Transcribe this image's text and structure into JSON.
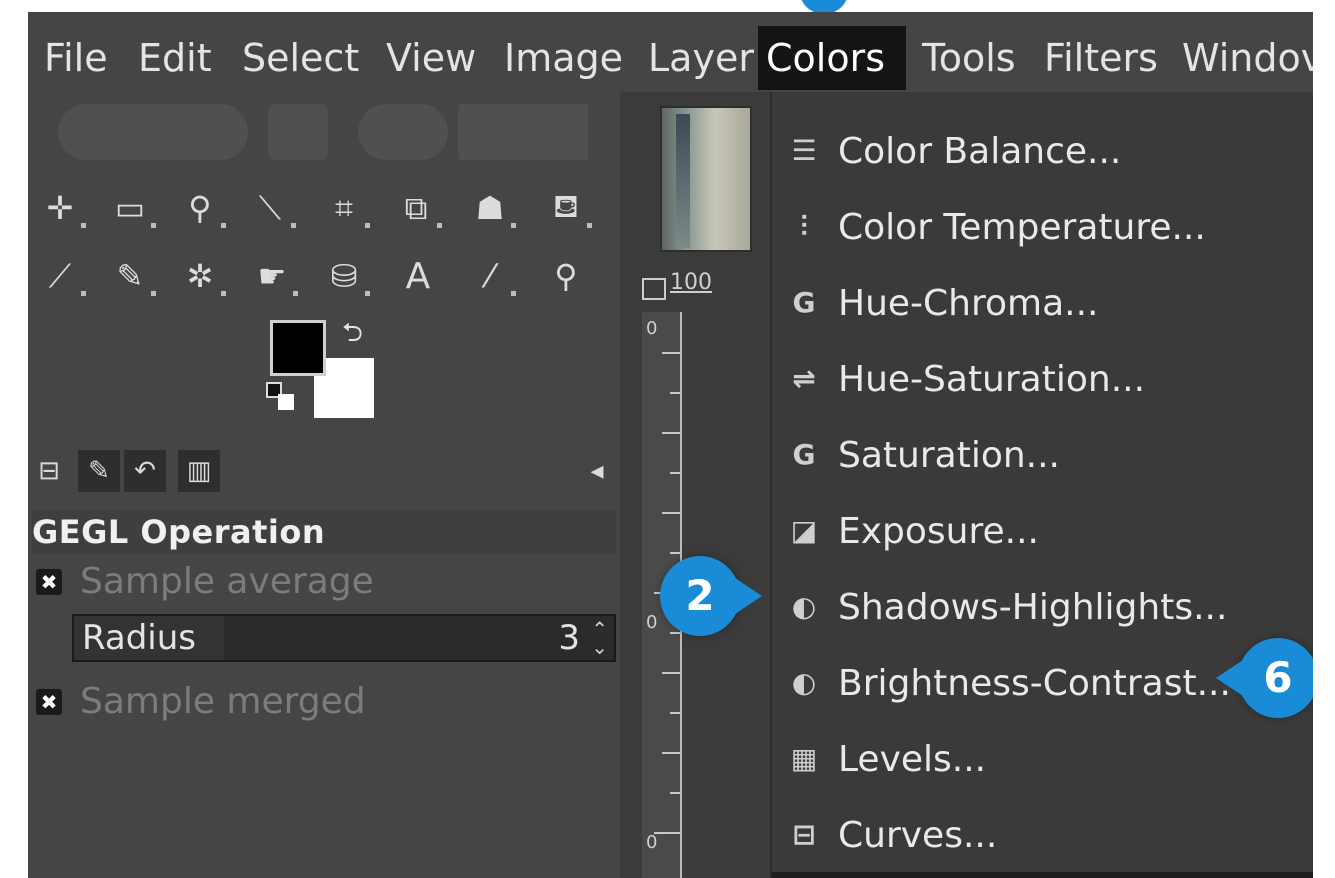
{
  "menubar": {
    "items": [
      {
        "label": "File",
        "active": false
      },
      {
        "label": "Edit",
        "active": false
      },
      {
        "label": "Select",
        "active": false
      },
      {
        "label": "View",
        "active": false
      },
      {
        "label": "Image",
        "active": false
      },
      {
        "label": "Layer",
        "active": false
      },
      {
        "label": "Colors",
        "active": true
      },
      {
        "label": "Tools",
        "active": false
      },
      {
        "label": "Filters",
        "active": false
      },
      {
        "label": "Windov",
        "active": false
      }
    ]
  },
  "toolbox": {
    "tools_row1": [
      "move-tool-icon",
      "rect-select-icon",
      "lasso-icon",
      "fuzzy-select-icon",
      "crop-icon",
      "transform-icon",
      "warp-icon",
      "bucket-fill-icon"
    ],
    "tools_row2": [
      "paintbrush-icon",
      "eraser-icon",
      "airbrush-icon",
      "smudge-icon",
      "clone-icon",
      "text-icon",
      "color-picker-icon",
      "zoom-icon"
    ],
    "dock_tabs": [
      "tool-options-icon",
      "device-status-icon",
      "undo-history-icon",
      "images-icon"
    ],
    "foreground_color": "#000000",
    "background_color": "#ffffff"
  },
  "tool_options": {
    "title": "GEGL Operation",
    "sample_average_label": "Sample average",
    "radius_label": "Radius",
    "radius_value": "3",
    "sample_merged_label": "Sample merged"
  },
  "canvas": {
    "zoom_label": "100",
    "ruler_label_top": "0",
    "ruler_label_mid": "0",
    "ruler_label_bottom": "0"
  },
  "colors_menu": {
    "items": [
      {
        "label": "Color Balance...",
        "icon": "color-balance-icon",
        "glyph": "☰"
      },
      {
        "label": "Color Temperature...",
        "icon": "color-temperature-icon",
        "glyph": "⫶"
      },
      {
        "label": "Hue-Chroma...",
        "icon": "gegl-icon",
        "glyph": "G"
      },
      {
        "label": "Hue-Saturation...",
        "icon": "hue-saturation-icon",
        "glyph": "⇌"
      },
      {
        "label": "Saturation...",
        "icon": "gegl-icon",
        "glyph": "G"
      },
      {
        "label": "Exposure...",
        "icon": "exposure-icon",
        "glyph": "◪"
      },
      {
        "label": "Shadows-Highlights...",
        "icon": "shadows-highlights-icon",
        "glyph": "◐"
      },
      {
        "label": "Brightness-Contrast...",
        "icon": "brightness-contrast-icon",
        "glyph": "◐"
      },
      {
        "label": "Levels...",
        "icon": "levels-icon",
        "glyph": "▦"
      },
      {
        "label": "Curves...",
        "icon": "curves-icon",
        "glyph": "⊟"
      }
    ]
  },
  "callouts": {
    "shadows": "2",
    "brightness": "6"
  },
  "colors": {
    "panel_bg": "#454545",
    "menu_bg": "#3a3a3a",
    "active_menu_bg": "#141414",
    "callout_blue": "#1a8bd6"
  }
}
